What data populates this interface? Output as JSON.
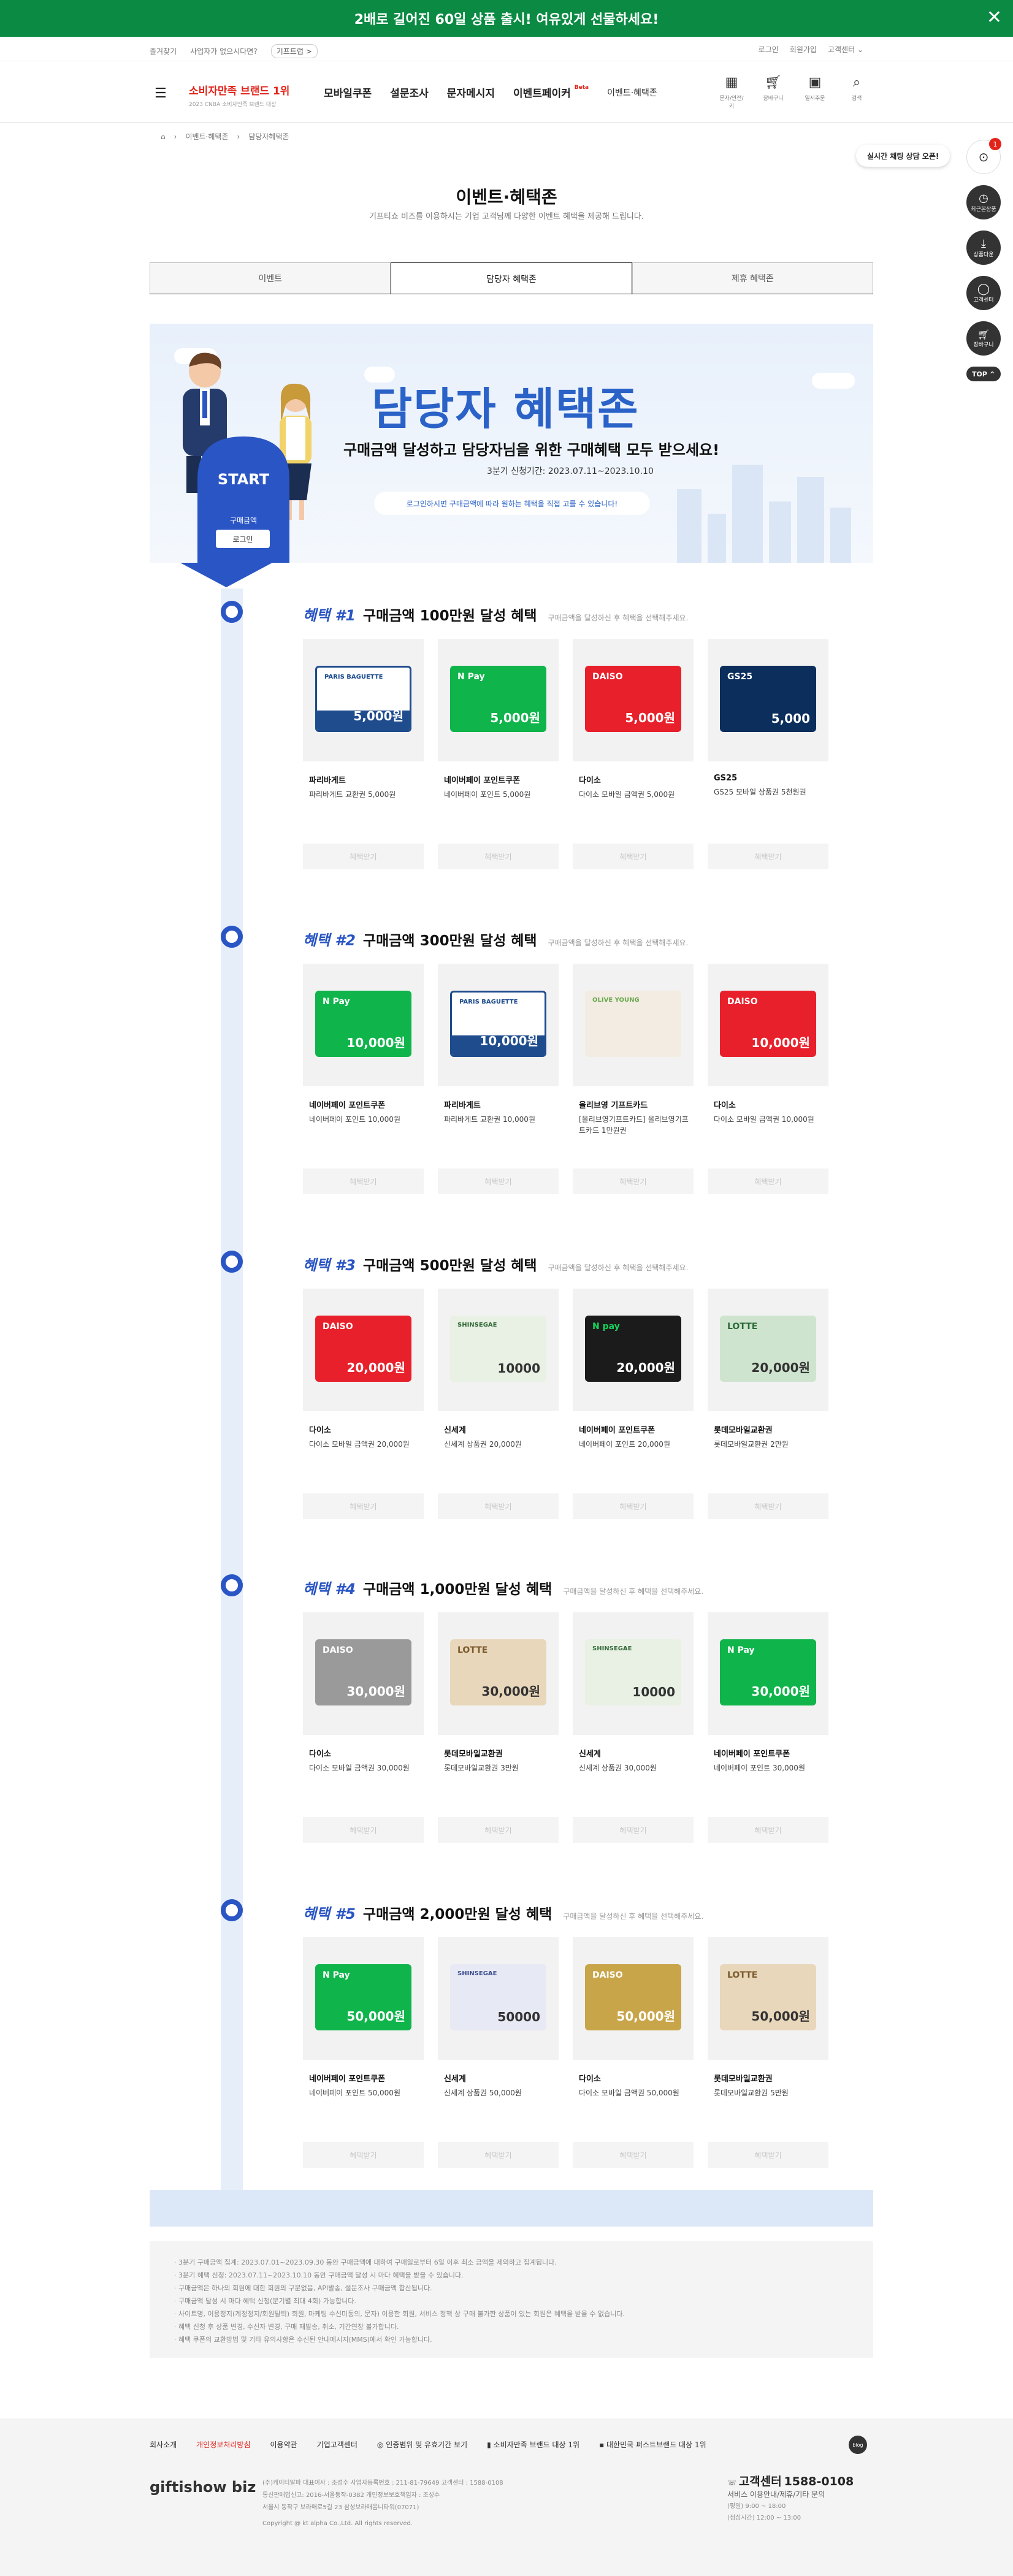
{
  "promo_bar": {
    "text": "2배로 길어진 60일 상품 출시! 여유있게 선물하세요!"
  },
  "util": {
    "left": [
      "즐겨찾기",
      "사업자가 없으시다면?"
    ],
    "tag": "기프트럽 >",
    "right": [
      "로그인",
      "회원가입",
      "고객센터 ⌄"
    ]
  },
  "header": {
    "brand": "소비자만족 브랜드 1위",
    "brand_sub": "2023 CNBA 소비자만족 브랜드 대상",
    "nav": [
      "모바일쿠폰",
      "설문조사",
      "문자메시지",
      "이벤트페이커"
    ],
    "beta": "Beta",
    "nav_sub": "이벤트·혜택존",
    "icons": [
      {
        "icon": "calendar-icon",
        "label": "문자/안전/키"
      },
      {
        "icon": "cart-icon",
        "label": "장바구니"
      },
      {
        "icon": "calendar-check-icon",
        "label": "일시주문"
      },
      {
        "icon": "search-icon",
        "label": "검색"
      }
    ]
  },
  "breadcrumb": [
    "이벤트·혜택존",
    "담당자혜택존"
  ],
  "page": {
    "title": "이벤트·혜택존",
    "subtitle": "기프티쇼 비즈를 이용하시는 기업 고객님께 다양한 이벤트 혜택을 제공해 드립니다."
  },
  "tabs": [
    {
      "label": "이벤트",
      "active": false
    },
    {
      "label": "담당자 혜택존",
      "active": true
    },
    {
      "label": "제휴 혜택존",
      "active": false
    }
  ],
  "hero": {
    "title": "담당자 혜택존",
    "subtitle": "구매금액 달성하고 담당자님을 위한 구매혜택 모두 받으세요!",
    "period": "3분기 신청기간: 2023.07.11~2023.10.10",
    "notice": "로그인하시면 구매금액에 따라 원하는 혜택을 직접 고를 수 있습니다!",
    "start": "START",
    "purchase_label": "구매금액",
    "login_btn": "로그인"
  },
  "benefits": [
    {
      "num": "혜택 #1",
      "title": "구매금액 100만원 달성 혜택",
      "desc": "구매금액을 달성하신 후 혜택을 선택해주세요.",
      "items": [
        {
          "name": "파리바게트",
          "sub": "파리바게트 교환권 5,000원",
          "face": "5,000원",
          "kind": "paris"
        },
        {
          "name": "네이버페이 포인트쿠폰",
          "sub": "네이버페이 포인트 5,000원",
          "face": "5,000원",
          "kind": "npay"
        },
        {
          "name": "다이소",
          "sub": "다이소 모바일 금액권 5,000원",
          "face": "5,000원",
          "kind": "daiso-red"
        },
        {
          "name": "GS25",
          "sub": "GS25 모바일 상품권 5천원권",
          "face": "5,000",
          "kind": "gs25"
        }
      ]
    },
    {
      "num": "혜택 #2",
      "title": "구매금액 300만원 달성 혜택",
      "desc": "구매금액을 달성하신 후 혜택을 선택해주세요.",
      "items": [
        {
          "name": "네이버페이 포인트쿠폰",
          "sub": "네이버페이 포인트 10,000원",
          "face": "10,000원",
          "kind": "npay"
        },
        {
          "name": "파리바게트",
          "sub": "파리바게트 교환권 10,000원",
          "face": "10,000원",
          "kind": "paris"
        },
        {
          "name": "올리브영 기프트카드",
          "sub": "[올리브영기프트카드] 올리브영기프트카드 1만원권",
          "face": "",
          "kind": "olive"
        },
        {
          "name": "다이소",
          "sub": "다이소 모바일 금액권 10,000원",
          "face": "10,000원",
          "kind": "daiso-red"
        }
      ]
    },
    {
      "num": "혜택 #3",
      "title": "구매금액 500만원 달성 혜택",
      "desc": "구매금액을 달성하신 후 혜택을 선택해주세요.",
      "items": [
        {
          "name": "다이소",
          "sub": "다이소 모바일 금액권 20,000원",
          "face": "20,000원",
          "kind": "daiso-red"
        },
        {
          "name": "신세계",
          "sub": "신세계 상품권 20,000원",
          "face": "10000",
          "kind": "ssg"
        },
        {
          "name": "네이버페이 포인트쿠폰",
          "sub": "네이버페이 포인트 20,000원",
          "face": "20,000원",
          "kind": "npay-black"
        },
        {
          "name": "롯데모바일교환권",
          "sub": "롯데모바일교환권 2만원",
          "face": "20,000원",
          "kind": "lotte-green"
        }
      ]
    },
    {
      "num": "혜택 #4",
      "title": "구매금액 1,000만원 달성 혜택",
      "desc": "구매금액을 달성하신 후 혜택을 선택해주세요.",
      "items": [
        {
          "name": "다이소",
          "sub": "다이소 모바일 금액권 30,000원",
          "face": "30,000원",
          "kind": "daiso-silver"
        },
        {
          "name": "롯데모바일교환권",
          "sub": "롯데모바일교환권 3만원",
          "face": "30,000원",
          "kind": "lotte-tan"
        },
        {
          "name": "신세계",
          "sub": "신세계 상품권 30,000원",
          "face": "10000",
          "kind": "ssg"
        },
        {
          "name": "네이버페이 포인트쿠폰",
          "sub": "네이버페이 포인트 30,000원",
          "face": "30,000원",
          "kind": "npay"
        }
      ]
    },
    {
      "num": "혜택 #5",
      "title": "구매금액 2,000만원 달성 혜택",
      "desc": "구매금액을 달성하신 후 혜택을 선택해주세요.",
      "items": [
        {
          "name": "네이버페이 포인트쿠폰",
          "sub": "네이버페이 포인트 50,000원",
          "face": "50,000원",
          "kind": "npay"
        },
        {
          "name": "신세계",
          "sub": "신세계 상품권 50,000원",
          "face": "50000",
          "kind": "ssg-blue"
        },
        {
          "name": "다이소",
          "sub": "다이소 모바일 금액권 50,000원",
          "face": "50,000원",
          "kind": "daiso-gold"
        },
        {
          "name": "롯데모바일교환권",
          "sub": "롯데모바일교환권 5만원",
          "face": "50,000원",
          "kind": "lotte-tan"
        }
      ]
    }
  ],
  "select_label": "혜택받기",
  "notes": [
    "3분기 구매금액 집계: 2023.07.01~2023.09.30 동안 구매금액에 대하여 구매일로부터 6일 이후 최소 금액을 제외하고 집계됩니다.",
    "3분기 혜택 신청: 2023.07.11~2023.10.10 동안 구매금액 달성 시 마다 혜택을 받을 수 있습니다.",
    "구매금액은 하나의 회원에 대한 회원의 구분없음, API발송, 설문조사 구매금액 합산됩니다.",
    "구매금액 달성 시 마다 혜택 신청(분기별 최대 4회) 가능합니다.",
    "사이트명, 이용정지(계정정지/회원탈퇴) 회원, 마케팅 수신미동의, 문자) 이용한 회원, 서비스 정책 상 구매 불가한 상품이 있는 회원은 혜택을 받을 수 없습니다.",
    "혜택 신청 후 상품 변경, 수신자 변경, 구매 재발송, 취소, 기간연장 불가합니다.",
    "혜택 쿠폰의 교환방법 및 기타 유의사항은 수신된 안내메시지(MMS)에서 확인 가능합니다."
  ],
  "footer": {
    "links": [
      "회사소개",
      "개인정보처리방침",
      "이용약관",
      "기업고객센터",
      "인증범위 및 유효기간 보기",
      "소비자만족 브랜드 대상 1위",
      "대한민국 퍼스트브랜드 대상 1위"
    ],
    "logo": "giftishow biz",
    "info": [
      "(주)케이티알파   대표이사 : 조성수   사업자등록번호 : 211-81-79649   고객센터 : 1588-0108",
      "통신판매업신고: 2016-서울동작-0382   개인정보보호책임자 : 조성수",
      "서울시 동작구 보라매로5길 23 삼성보라매옴니타워(07071)",
      "Copyright @ kt alpha Co.,Ltd. All rights reserved."
    ],
    "cs_label": "고객센터",
    "cs_phone": "1588-0108",
    "cs_lines": [
      "서비스 이용안내/제휴/기타 문의",
      "(평일) 9:00 ~ 18:00",
      "(점심시간) 12:00 ~ 13:00"
    ]
  },
  "quick": {
    "chat": "실시간 채팅 상담 오픈!",
    "badge": "1",
    "items": [
      "최근본상품",
      "상품다운",
      "고객센터",
      "장바구니"
    ],
    "top": "TOP ^"
  },
  "colors": {
    "accent": "#2a55c4",
    "brand_red": "#e2231a",
    "promo_green": "#0a8a43"
  }
}
